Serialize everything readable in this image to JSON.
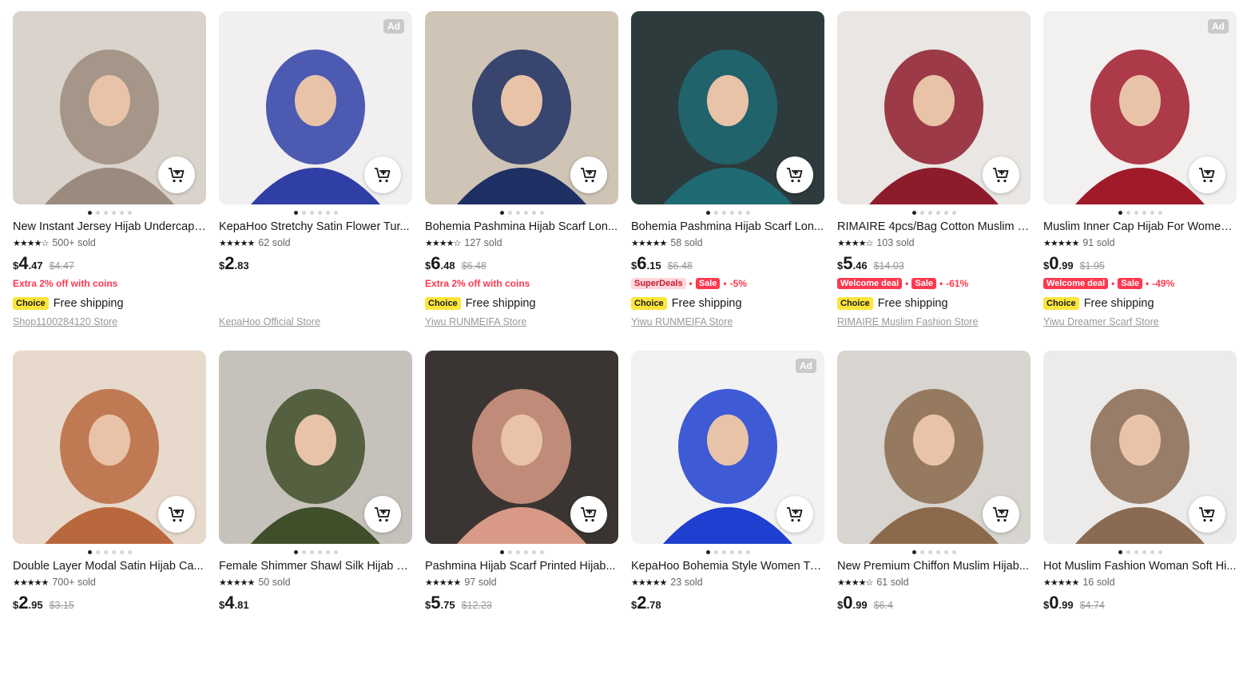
{
  "products": [
    {
      "title": "New Instant Jersey Hijab Undercap ...",
      "stars": "★★★★☆",
      "sold": "500+ sold",
      "currency": "$",
      "price_int": "4",
      "price_cents": ".47",
      "old_price": "$4.47",
      "promo_text": "Extra 2% off with coins",
      "tags": [],
      "discount": "",
      "choice": "Choice",
      "shipping": "Free shipping",
      "store": "Shop1100284120 Store",
      "ad": "",
      "img_bg": "#d9d3cb",
      "accent": "#9b8b7e"
    },
    {
      "title": "KepaHoo Stretchy Satin Flower Tur...",
      "stars": "★★★★★",
      "sold": "62 sold",
      "currency": "$",
      "price_int": "2",
      "price_cents": ".83",
      "old_price": "",
      "promo_text": "",
      "tags": [],
      "discount": "",
      "choice": "",
      "shipping": "",
      "store": "KepaHoo Official Store",
      "ad": "Ad",
      "img_bg": "#f1efef",
      "accent": "#2f3fa6"
    },
    {
      "title": "Bohemia Pashmina Hijab Scarf Lon...",
      "stars": "★★★★☆",
      "sold": "127 sold",
      "currency": "$",
      "price_int": "6",
      "price_cents": ".48",
      "old_price": "$6.48",
      "promo_text": "Extra 2% off with coins",
      "tags": [],
      "discount": "",
      "choice": "Choice",
      "shipping": "Free shipping",
      "store": "Yiwu RUNMEIFA Store",
      "ad": "",
      "img_bg": "#cfc4b5",
      "accent": "#1d2f63"
    },
    {
      "title": "Bohemia Pashmina Hijab Scarf Lon...",
      "stars": "★★★★★",
      "sold": "58 sold",
      "currency": "$",
      "price_int": "6",
      "price_cents": ".15",
      "old_price": "$6.48",
      "promo_text": "",
      "tags": [
        "SuperDeals",
        "Sale"
      ],
      "discount": "-5%",
      "choice": "Choice",
      "shipping": "Free shipping",
      "store": "Yiwu RUNMEIFA Store",
      "ad": "",
      "img_bg": "#2e3b3c",
      "accent": "#1f6b73"
    },
    {
      "title": "RIMAIRE 4pcs/Bag Cotton Muslim H...",
      "stars": "★★★★☆",
      "sold": "103 sold",
      "currency": "$",
      "price_int": "5",
      "price_cents": ".46",
      "old_price": "$14.03",
      "promo_text": "",
      "tags": [
        "Welcome deal",
        "Sale"
      ],
      "discount": "-61%",
      "choice": "Choice",
      "shipping": "Free shipping",
      "store": "RIMAIRE Muslim Fashion Store",
      "ad": "",
      "img_bg": "#e9e6e3",
      "accent": "#8e1b2c"
    },
    {
      "title": "Muslim Inner Cap Hijab For Women...",
      "stars": "★★★★★",
      "sold": "91 sold",
      "currency": "$",
      "price_int": "0",
      "price_cents": ".99",
      "old_price": "$1.95",
      "promo_text": "",
      "tags": [
        "Welcome deal",
        "Sale"
      ],
      "discount": "-49%",
      "choice": "Choice",
      "shipping": "Free shipping",
      "store": "Yiwu Dreamer Scarf Store",
      "ad": "Ad",
      "img_bg": "#f3f1ef",
      "accent": "#a01a2a"
    },
    {
      "title": "Double Layer Modal Satin Hijab Ca...",
      "stars": "★★★★★",
      "sold": "700+ sold",
      "currency": "$",
      "price_int": "2",
      "price_cents": ".95",
      "old_price": "$3.15",
      "promo_text": "",
      "tags": [],
      "discount": "",
      "choice": "",
      "shipping": "",
      "store": "",
      "ad": "",
      "img_bg": "#e7d9cb",
      "accent": "#b9683e"
    },
    {
      "title": "Female Shimmer Shawl Silk Hijab S...",
      "stars": "★★★★★",
      "sold": "50 sold",
      "currency": "$",
      "price_int": "4",
      "price_cents": ".81",
      "old_price": "",
      "promo_text": "",
      "tags": [],
      "discount": "",
      "choice": "",
      "shipping": "",
      "store": "",
      "ad": "",
      "img_bg": "#c6c2bb",
      "accent": "#3f4f2a"
    },
    {
      "title": "Pashmina Hijab Scarf Printed Hijab...",
      "stars": "★★★★★",
      "sold": "97 sold",
      "currency": "$",
      "price_int": "5",
      "price_cents": ".75",
      "old_price": "$12.23",
      "promo_text": "",
      "tags": [],
      "discount": "",
      "choice": "",
      "shipping": "",
      "store": "",
      "ad": "",
      "img_bg": "#3a3532",
      "accent": "#d89a86"
    },
    {
      "title": "KepaHoo Bohemia Style Women Tu...",
      "stars": "★★★★★",
      "sold": "23 sold",
      "currency": "$",
      "price_int": "2",
      "price_cents": ".78",
      "old_price": "",
      "promo_text": "",
      "tags": [],
      "discount": "",
      "choice": "",
      "shipping": "",
      "store": "",
      "ad": "Ad",
      "img_bg": "#f2f2f2",
      "accent": "#1e3fd0"
    },
    {
      "title": "New Premium Chiffon Muslim Hijab...",
      "stars": "★★★★☆",
      "sold": "61 sold",
      "currency": "$",
      "price_int": "0",
      "price_cents": ".99",
      "old_price": "$6.4",
      "promo_text": "",
      "tags": [],
      "discount": "",
      "choice": "",
      "shipping": "",
      "store": "",
      "ad": "",
      "img_bg": "#d8d4cf",
      "accent": "#8b6a4c"
    },
    {
      "title": "Hot Muslim Fashion Woman Soft Hi...",
      "stars": "★★★★★",
      "sold": "16 sold",
      "currency": "$",
      "price_int": "0",
      "price_cents": ".99",
      "old_price": "$4.74",
      "promo_text": "",
      "tags": [],
      "discount": "",
      "choice": "",
      "shipping": "",
      "store": "",
      "ad": "",
      "img_bg": "#ecebe9",
      "accent": "#8a6a52"
    }
  ]
}
